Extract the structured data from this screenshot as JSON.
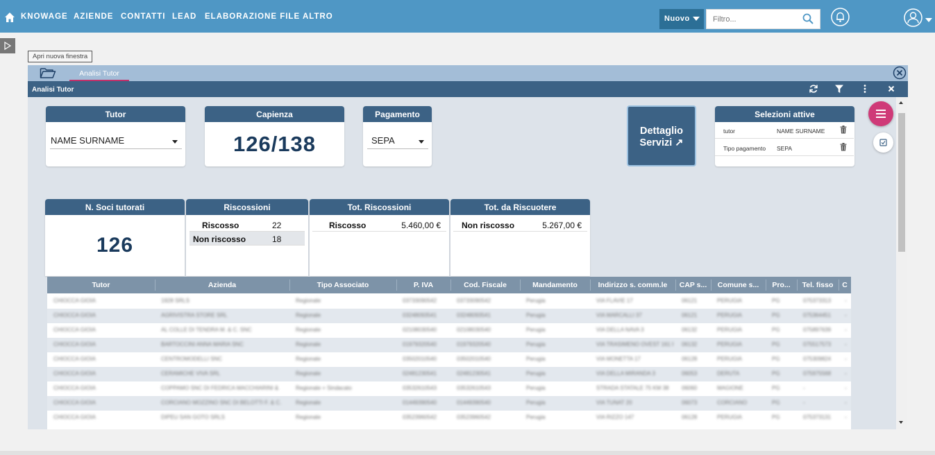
{
  "nav": {
    "items": [
      "KNOWAGE",
      "AZIENDE",
      "CONTATTI",
      "LEAD",
      "ELABORAZIONE FILE",
      "ALTRO"
    ],
    "nuovo_label": "Nuovo",
    "filter_placeholder": "Filtro..."
  },
  "tooltip": "Apri nuova finestra",
  "window": {
    "tab_label": "Analisi Tutor",
    "title": "Analisi Tutor"
  },
  "tutor": {
    "header": "Tutor",
    "value": "NAME SURNAME"
  },
  "capienza": {
    "header": "Capienza",
    "value": "126/138"
  },
  "pagamento": {
    "header": "Pagamento",
    "value": "SEPA"
  },
  "dettaglio": {
    "line1": "Dettaglio",
    "line2": "Servizi ↗"
  },
  "selezioni": {
    "header": "Selezioni attive",
    "rows": [
      {
        "key": "tutor",
        "value": "NAME SURNAME"
      },
      {
        "key": "Tipo pagamento",
        "value": "SEPA"
      }
    ]
  },
  "soci": {
    "header": "N. Soci tutorati",
    "value": "126"
  },
  "riscossioni": {
    "header": "Riscossioni",
    "rows": [
      {
        "label": "Riscosso",
        "value": "22"
      },
      {
        "label": "Non riscosso",
        "value": "18"
      }
    ]
  },
  "tot_riscossioni": {
    "header": "Tot. Riscossioni",
    "label": "Riscosso",
    "value": "5.460,00 €"
  },
  "tot_da_riscuotere": {
    "header": "Tot. da Riscuotere",
    "label": "Non riscosso",
    "value": "5.267,00 €"
  },
  "table": {
    "columns": [
      "Tutor",
      "Azienda",
      "Tipo Associato",
      "P. IVA",
      "Cod. Fiscale",
      "Mandamento",
      "Indirizzo s. comm.le",
      "CAP s...",
      "Comune s...",
      "Pro...",
      "Tel. fisso",
      "C"
    ],
    "rows": [
      [
        "CHIOCCA GIOIA",
        "1928 SRLS",
        "Regionale",
        "03733090542",
        "03733090542",
        "Perugia",
        "VIA FLAVIE 17",
        "06121",
        "PERUGIA",
        "PG",
        "075373313",
        "-"
      ],
      [
        "CHIOCCA GIOIA",
        "AGRIVISTRA STORE SRL",
        "Regionale",
        "03248093541",
        "03248093541",
        "Perugia",
        "VIA MARCALLI 37",
        "06121",
        "PERUGIA",
        "PG",
        "075364451",
        "-"
      ],
      [
        "CHIOCCA GIOIA",
        "AL COLLE DI TENDRA M. & C. SNC",
        "Regionale",
        "02108030540",
        "02108030540",
        "Perugia",
        "VIA DELLA NAVA 3",
        "06132",
        "PERUGIA",
        "PG",
        "075897639",
        "-"
      ],
      [
        "CHIOCCA GIOIA",
        "BARTOCCINI ANNA MARIA SNC",
        "Regionale",
        "01979320540",
        "01979320540",
        "Perugia",
        "VIA TRASIMENO OVEST 161 F",
        "06132",
        "PERUGIA",
        "PG",
        "075517573",
        "-"
      ],
      [
        "CHIOCCA GIOIA",
        "CENTROMODELLI SNC",
        "Regionale",
        "03502010540",
        "03502010540",
        "Perugia",
        "VIA MONETTA 17",
        "06128",
        "PERUGIA",
        "PG",
        "075309824",
        "-"
      ],
      [
        "CHIOCCA GIOIA",
        "CERAMICHE VIVA SRL",
        "Regionale",
        "02481230541",
        "02481230541",
        "Perugia",
        "VIA DELLA MIRANDA 3",
        "06053",
        "DERUTA",
        "PG",
        "075975568",
        "-"
      ],
      [
        "CHIOCCA GIOIA",
        "COPPAMO SNC DI FEDRICA MACCHIARINI &",
        "Regionale + Sindacato",
        "03532610543",
        "03532610543",
        "Perugia",
        "STRADA STATALE 75 KM 38",
        "06060",
        "MAGIONE",
        "PG",
        "-",
        "-"
      ],
      [
        "CHIOCCA GIOIA",
        "CORCIANO MOZZINO SNC DI BELOTTI F. & C.",
        "Regionale",
        "01449390540",
        "01449390540",
        "Perugia",
        "VIA TUNAT 20",
        "06073",
        "CORCIANO",
        "PG",
        "-",
        "-"
      ],
      [
        "CHIOCCA GIOIA",
        "DIPEU SAN GOTO SRLS",
        "Regionale",
        "03523960542",
        "03523960542",
        "Perugia",
        "VIA RIZZO 147",
        "06128",
        "PERUGIA",
        "PG",
        "075373131",
        "-"
      ]
    ]
  }
}
